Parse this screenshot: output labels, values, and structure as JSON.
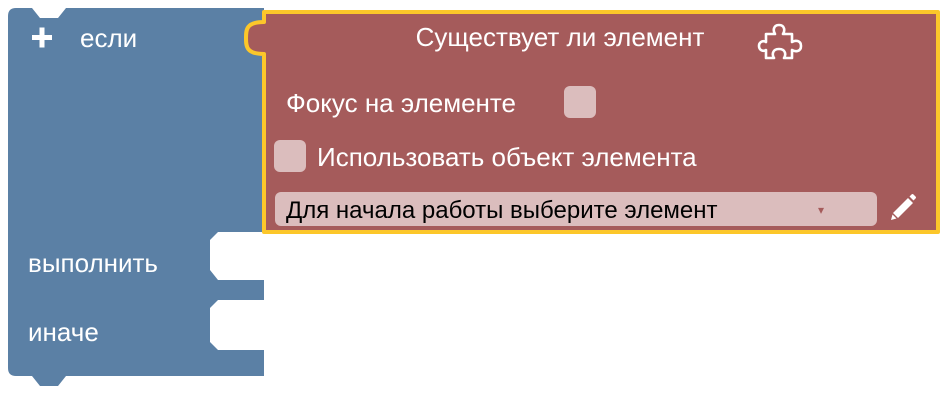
{
  "if_block": {
    "if_label": "если",
    "do_label": "выполнить",
    "else_label": "иначе",
    "plus_icon": "plus-icon",
    "color": "#5b80a5"
  },
  "element_block": {
    "title": "Существует ли элемент",
    "focus_label": "Фокус на элементе",
    "focus_checked": false,
    "use_object_label": "Использовать объект элемента",
    "use_object_checked": false,
    "dropdown_value": "Для начала работы выберите элемент",
    "dropdown_arrow": "▾",
    "puzzle_icon": "puzzle-icon",
    "edit_icon": "pencil-icon",
    "color": "#a55b5b",
    "highlight_color": "#fcc72a",
    "field_color": "#dbbdbd"
  }
}
